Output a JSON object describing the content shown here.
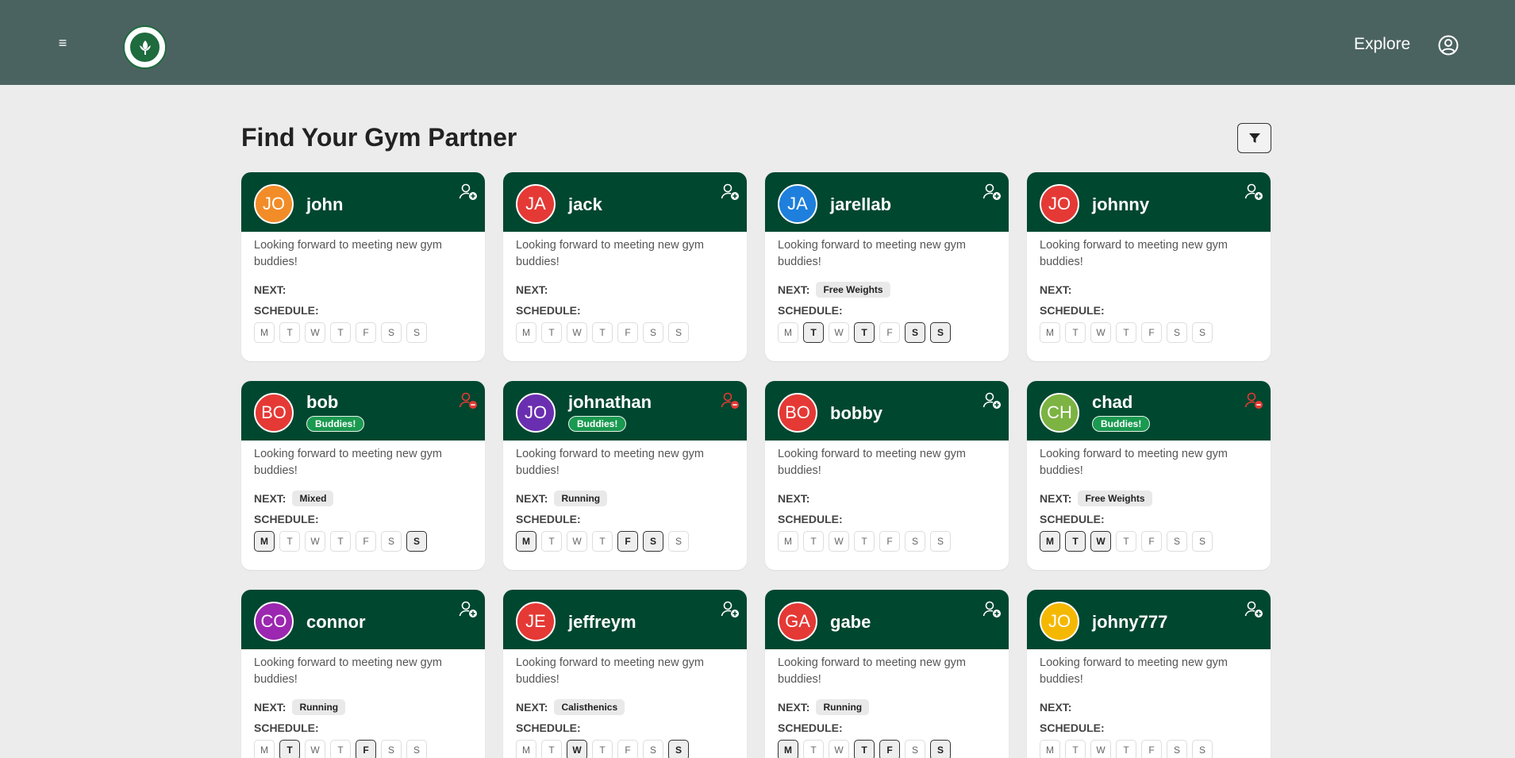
{
  "header": {
    "menu_icon": "≡",
    "explore_label": "Explore",
    "colors": {
      "bar": "#4b6360",
      "card_head": "#004730",
      "buddies": "#1a9950"
    }
  },
  "page": {
    "title": "Find Your Gym Partner"
  },
  "day_letters": [
    "M",
    "T",
    "W",
    "T",
    "F",
    "S",
    "S"
  ],
  "users": [
    {
      "initials": "JO",
      "name": "john",
      "color": "#f28c28",
      "buddy": false,
      "bio": "Looking forward to meeting new gym buddies!",
      "next_label": "NEXT:",
      "next": "",
      "schedule_label": "SCHEDULE:",
      "days": [
        false,
        false,
        false,
        false,
        false,
        false,
        false
      ]
    },
    {
      "initials": "JA",
      "name": "jack",
      "color": "#e53935",
      "buddy": false,
      "bio": "Looking forward to meeting new gym buddies!",
      "next_label": "NEXT:",
      "next": "",
      "schedule_label": "SCHEDULE:",
      "days": [
        false,
        false,
        false,
        false,
        false,
        false,
        false
      ]
    },
    {
      "initials": "JA",
      "name": "jarellab",
      "color": "#1e7fdc",
      "buddy": false,
      "bio": "Looking forward to meeting new gym buddies!",
      "next_label": "NEXT:",
      "next": "Free Weights",
      "schedule_label": "SCHEDULE:",
      "days": [
        false,
        true,
        false,
        true,
        false,
        true,
        true
      ]
    },
    {
      "initials": "JO",
      "name": "johnny",
      "color": "#e53935",
      "buddy": false,
      "bio": "Looking forward to meeting new gym buddies!",
      "next_label": "NEXT:",
      "next": "",
      "schedule_label": "SCHEDULE:",
      "days": [
        false,
        false,
        false,
        false,
        false,
        false,
        false
      ]
    },
    {
      "initials": "BO",
      "name": "bob",
      "color": "#e53935",
      "buddy": true,
      "buddy_label": "Buddies!",
      "bio": "Looking forward to meeting new gym buddies!",
      "next_label": "NEXT:",
      "next": "Mixed",
      "schedule_label": "SCHEDULE:",
      "days": [
        true,
        false,
        false,
        false,
        false,
        false,
        true
      ]
    },
    {
      "initials": "JO",
      "name": "johnathan",
      "color": "#6a2fb0",
      "buddy": true,
      "buddy_label": "Buddies!",
      "bio": "Looking forward to meeting new gym buddies!",
      "next_label": "NEXT:",
      "next": "Running",
      "schedule_label": "SCHEDULE:",
      "days": [
        true,
        false,
        false,
        false,
        true,
        true,
        false
      ]
    },
    {
      "initials": "BO",
      "name": "bobby",
      "color": "#e53935",
      "buddy": false,
      "bio": "Looking forward to meeting new gym buddies!",
      "next_label": "NEXT:",
      "next": "",
      "schedule_label": "SCHEDULE:",
      "days": [
        false,
        false,
        false,
        false,
        false,
        false,
        false
      ]
    },
    {
      "initials": "CH",
      "name": "chad",
      "color": "#7cb342",
      "buddy": true,
      "buddy_label": "Buddies!",
      "bio": "Looking forward to meeting new gym buddies!",
      "next_label": "NEXT:",
      "next": "Free Weights",
      "schedule_label": "SCHEDULE:",
      "days": [
        true,
        true,
        true,
        false,
        false,
        false,
        false
      ]
    },
    {
      "initials": "CO",
      "name": "connor",
      "color": "#9c27b0",
      "buddy": false,
      "bio": "Looking forward to meeting new gym buddies!",
      "next_label": "NEXT:",
      "next": "Running",
      "schedule_label": "SCHEDULE:",
      "days": [
        false,
        true,
        false,
        false,
        true,
        false,
        false
      ]
    },
    {
      "initials": "JE",
      "name": "jeffreym",
      "color": "#e53935",
      "buddy": false,
      "bio": "Looking forward to meeting new gym buddies!",
      "next_label": "NEXT:",
      "next": "Calisthenics",
      "schedule_label": "SCHEDULE:",
      "days": [
        false,
        false,
        true,
        false,
        false,
        false,
        true
      ]
    },
    {
      "initials": "GA",
      "name": "gabe",
      "color": "#e53935",
      "buddy": false,
      "bio": "Looking forward to meeting new gym buddies!",
      "next_label": "NEXT:",
      "next": "Running",
      "schedule_label": "SCHEDULE:",
      "days": [
        true,
        false,
        false,
        true,
        true,
        false,
        true
      ]
    },
    {
      "initials": "JO",
      "name": "johny777",
      "color": "#f5b800",
      "buddy": false,
      "bio": "Looking forward to meeting new gym buddies!",
      "next_label": "NEXT:",
      "next": "",
      "schedule_label": "SCHEDULE:",
      "days": [
        false,
        false,
        false,
        false,
        false,
        false,
        false
      ]
    }
  ]
}
